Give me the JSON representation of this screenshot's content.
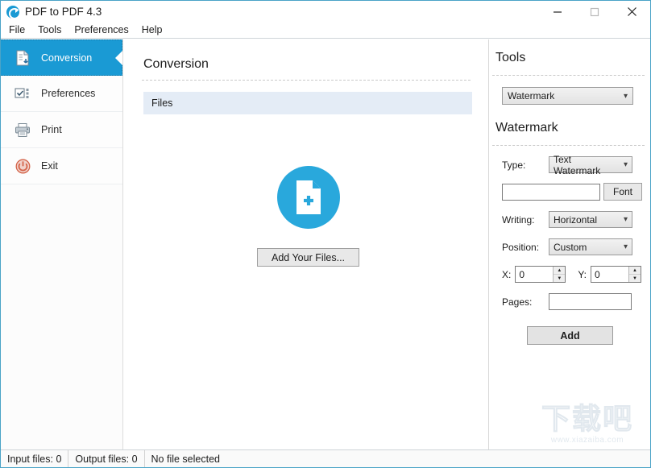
{
  "window": {
    "title": "PDF to PDF 4.3",
    "app_icon": "refresh-circle-icon",
    "minimize_label": "Minimize",
    "maximize_label": "Maximize",
    "close_label": "Close",
    "accent_color": "#1a9ad4",
    "border_color": "#4aa3c7"
  },
  "menubar": {
    "items": [
      {
        "label": "File"
      },
      {
        "label": "Tools"
      },
      {
        "label": "Preferences"
      },
      {
        "label": "Help"
      }
    ]
  },
  "sidebar": {
    "items": [
      {
        "label": "Conversion",
        "icon": "document-download-icon",
        "selected": true
      },
      {
        "label": "Preferences",
        "icon": "checkbox-list-icon",
        "selected": false
      },
      {
        "label": "Print",
        "icon": "printer-icon",
        "selected": false
      },
      {
        "label": "Exit",
        "icon": "power-icon",
        "selected": false
      }
    ]
  },
  "main": {
    "title": "Conversion",
    "files_header": "Files",
    "drop_icon": "document-add-circle-icon",
    "add_files_label": "Add Your Files..."
  },
  "tools": {
    "title": "Tools",
    "tool_select": {
      "value": "Watermark"
    },
    "section_title": "Watermark",
    "type": {
      "label": "Type:",
      "value": "Text Watermark"
    },
    "watermark_text": {
      "value": "",
      "placeholder": ""
    },
    "font_button": "Font",
    "writing": {
      "label": "Writing:",
      "value": "Horizontal"
    },
    "position": {
      "label": "Position:",
      "value": "Custom"
    },
    "x": {
      "label": "X:",
      "value": "0"
    },
    "y": {
      "label": "Y:",
      "value": "0"
    },
    "pages": {
      "label": "Pages:",
      "value": "",
      "placeholder": ""
    },
    "add_button": "Add"
  },
  "overlay_watermark": {
    "text_cn": "下载吧",
    "url": "www.xiazaiba.com"
  },
  "statusbar": {
    "input_files": "Input files: 0",
    "output_files": "Output files: 0",
    "selection": "No file selected"
  }
}
